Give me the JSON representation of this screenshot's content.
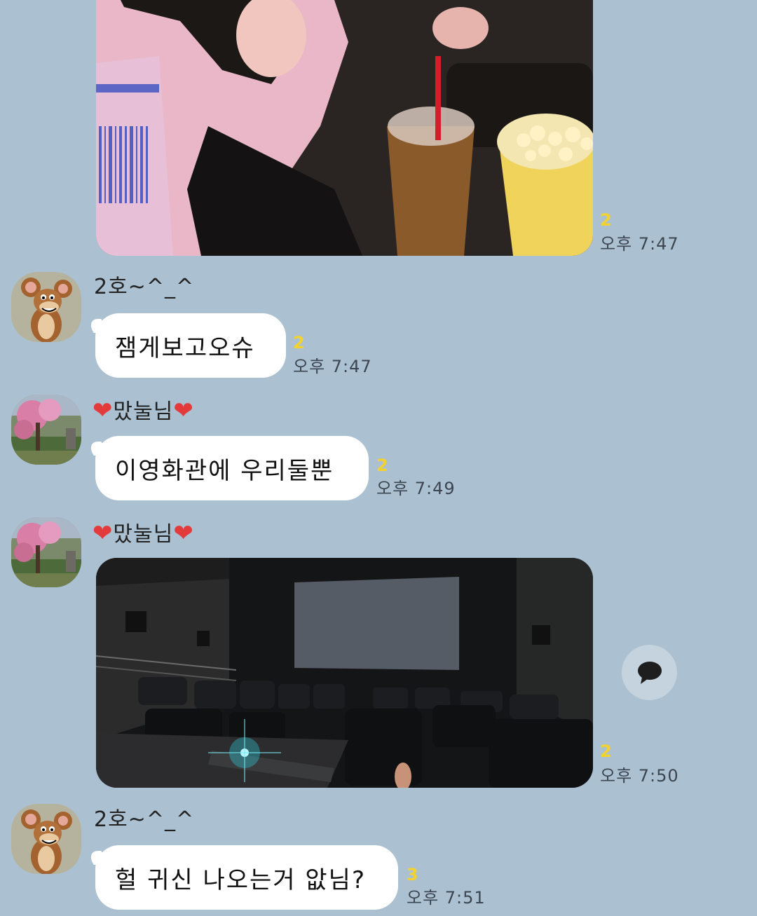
{
  "messages": [
    {
      "type": "photo",
      "alt": "",
      "unread": "2",
      "time": "오후 7:47"
    },
    {
      "type": "text",
      "sender": "2호~^_^",
      "avatar_icon": "cartoon-mouse-avatar",
      "text": "잼게보고오슈",
      "unread": "2",
      "time": "오후 7:47"
    },
    {
      "type": "text",
      "sender_prefix": "❤",
      "sender": "맜눌님",
      "sender_suffix": "❤",
      "avatar_icon": "blossom-tree-avatar",
      "text": "이영화관에 우리둘뿐",
      "unread": "2",
      "time": "오후 7:49"
    },
    {
      "type": "photo",
      "sender_prefix": "❤",
      "sender": "맜눌님",
      "sender_suffix": "❤",
      "avatar_icon": "blossom-tree-avatar",
      "unread": "2",
      "time": "오후 7:50"
    },
    {
      "type": "text",
      "sender": "2호~^_^",
      "avatar_icon": "cartoon-mouse-avatar",
      "text": "헐 귀신 나오는거 앖님?",
      "unread": "3",
      "time": "오후 7:51"
    }
  ],
  "colors": {
    "background": "#abc1d1",
    "bubble": "#ffffff",
    "unread": "#f4d22e",
    "heart": "#e33b3b"
  },
  "icons": {
    "comment_button": "speech-bubble-icon"
  }
}
